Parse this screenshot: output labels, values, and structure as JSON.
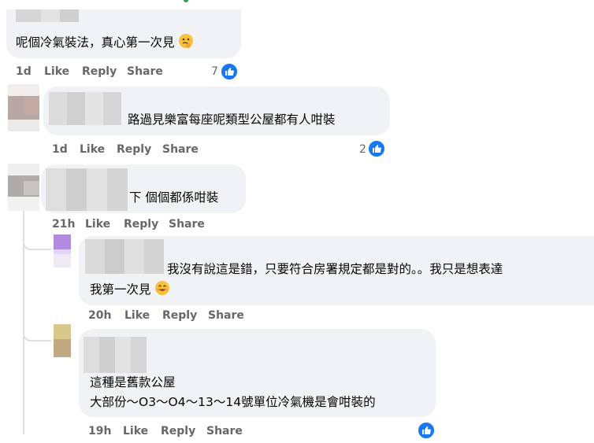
{
  "colors": {
    "bubble": "#f0f2f5",
    "meta": "#65676b",
    "accent": "#1877f2"
  },
  "comments": [
    {
      "text": "呢個冷氣裝法，真心第一次見",
      "emoji": "thinking-face",
      "time": "1d",
      "like": "Like",
      "reply": "Reply",
      "share": "Share",
      "reactions": "7"
    },
    {
      "text": "路過見樂富每座呢類型公屋都有人咁裝",
      "time": "1d",
      "like": "Like",
      "reply": "Reply",
      "share": "Share",
      "reactions": "2"
    },
    {
      "text": "下 個個都係咁裝",
      "time": "21h",
      "like": "Like",
      "reply": "Reply",
      "share": "Share"
    },
    {
      "line1": "我沒有說這是錯，只要符合房署規定都是對的。。我只是想表達",
      "line2": "我第一次見",
      "emoji": "smiling-face",
      "time": "20h",
      "like": "Like",
      "reply": "Reply",
      "share": "Share"
    },
    {
      "line1": "這種是舊款公屋",
      "line2": "大部份～O3～O4～13～14號單位冷氣機是會咁裝的",
      "time": "19h",
      "like": "Like",
      "reply": "Reply",
      "share": "Share"
    }
  ]
}
